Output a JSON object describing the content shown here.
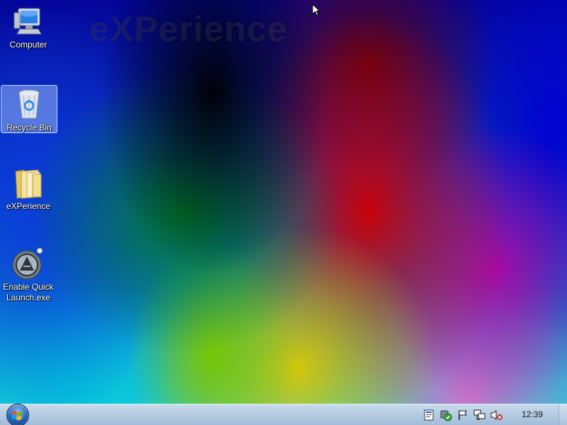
{
  "wallpaper": {
    "logo_text": "eXPerience"
  },
  "desktop": {
    "icons": [
      {
        "label": "Computer",
        "icon": "computer-icon"
      },
      {
        "label": "Recycle Bin",
        "icon": "recycle-bin-icon",
        "selected": true
      },
      {
        "label": "eXPerience",
        "icon": "folder-icon"
      },
      {
        "label": "Enable Quick Launch.exe",
        "icon": "app-launch-icon"
      }
    ]
  },
  "taskbar": {
    "start_icon": "windows-logo-icon",
    "tray_icons": [
      "notes-icon",
      "security-check-icon",
      "action-center-flag-icon",
      "network-icon",
      "volume-muted-icon"
    ],
    "clock": "12:39"
  },
  "colors": {
    "taskbar": "#b4cbe2",
    "label_text": "#ffffff",
    "selection": "#b4d2ff"
  }
}
